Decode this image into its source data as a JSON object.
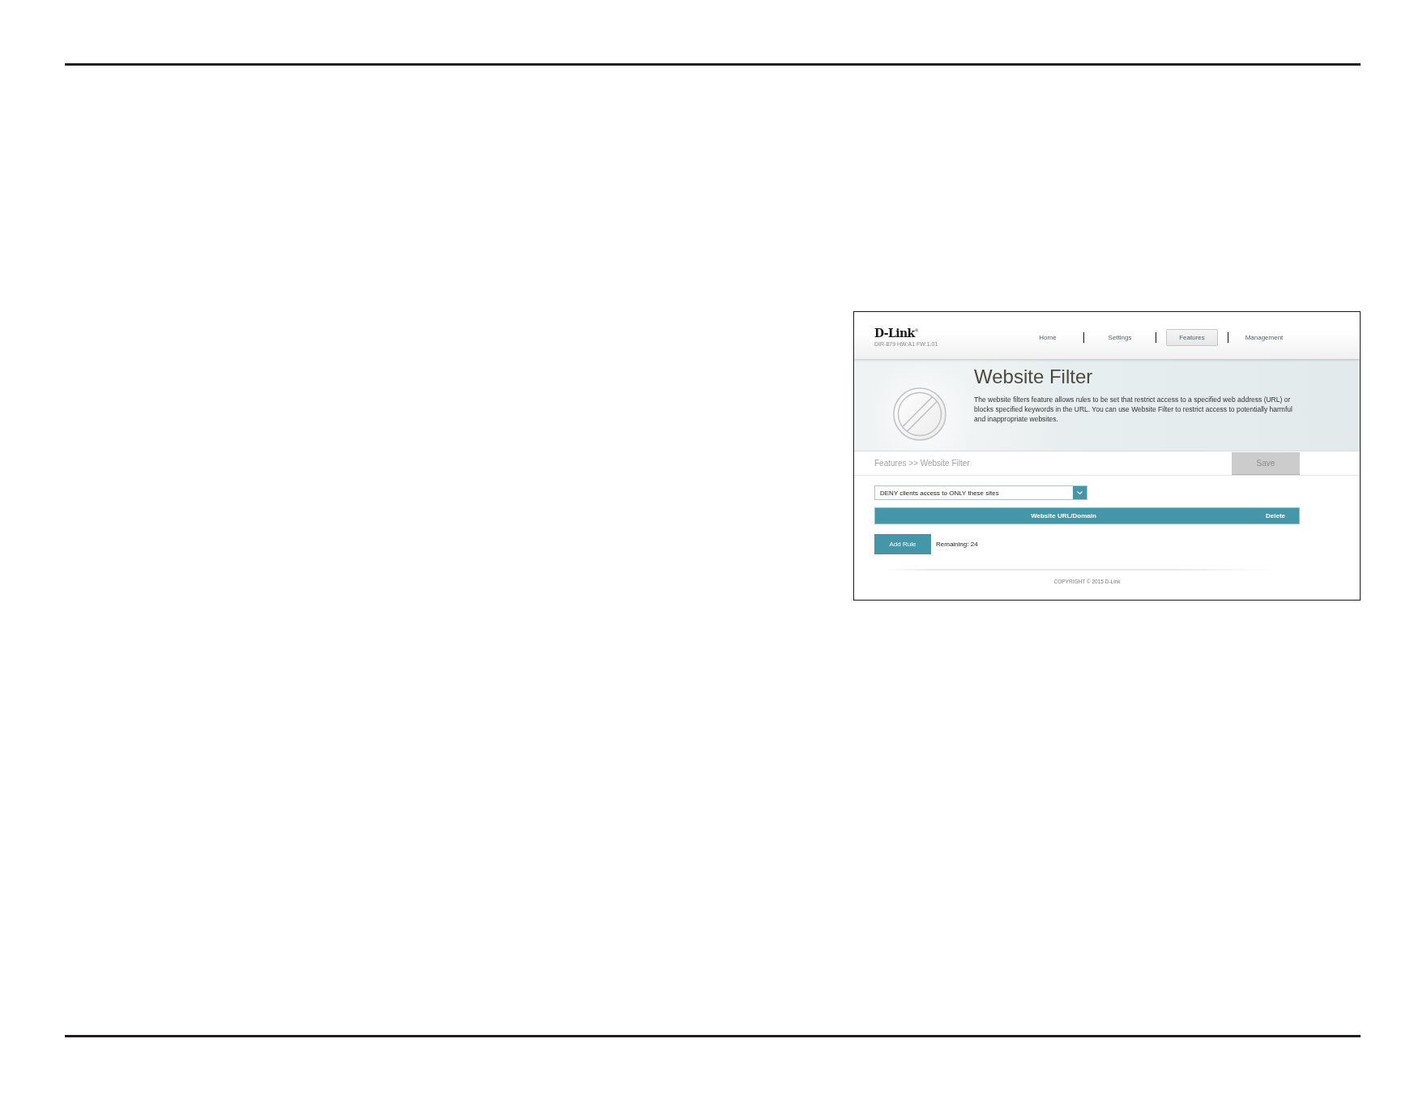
{
  "header": {
    "logo": "D-Link$^{®}$",
    "model": "DIR-879 HW:A1 FW:1.01",
    "nav": [
      {
        "label": "Home",
        "selected": false
      },
      {
        "label": "Settings",
        "selected": false
      },
      {
        "label": "Features",
        "selected": true
      },
      {
        "label": "Management",
        "selected": false
      }
    ]
  },
  "banner": {
    "title": "Website Filter",
    "description": "The website filters feature allows rules to be set that restrict access to a specified web address (URL) or blocks specified keywords in the URL. You can use Website Filter to restrict access to potentially harmful and inappropriate websites."
  },
  "toolbar": {
    "breadcrumb": "Features >> Website Filter",
    "save": {
      "label": "Save",
      "disabled": true
    }
  },
  "filter_mode": {
    "value": "DENY clients access to ONLY these sites"
  },
  "table": {
    "columns": [
      "Website URL/Domain",
      "Delete"
    ]
  },
  "add_rule": {
    "label": "Add Rule"
  },
  "remaining": "Remaining: 24",
  "footer": {
    "copyright": "COPYRIGHT © 2015 D-Link"
  }
}
